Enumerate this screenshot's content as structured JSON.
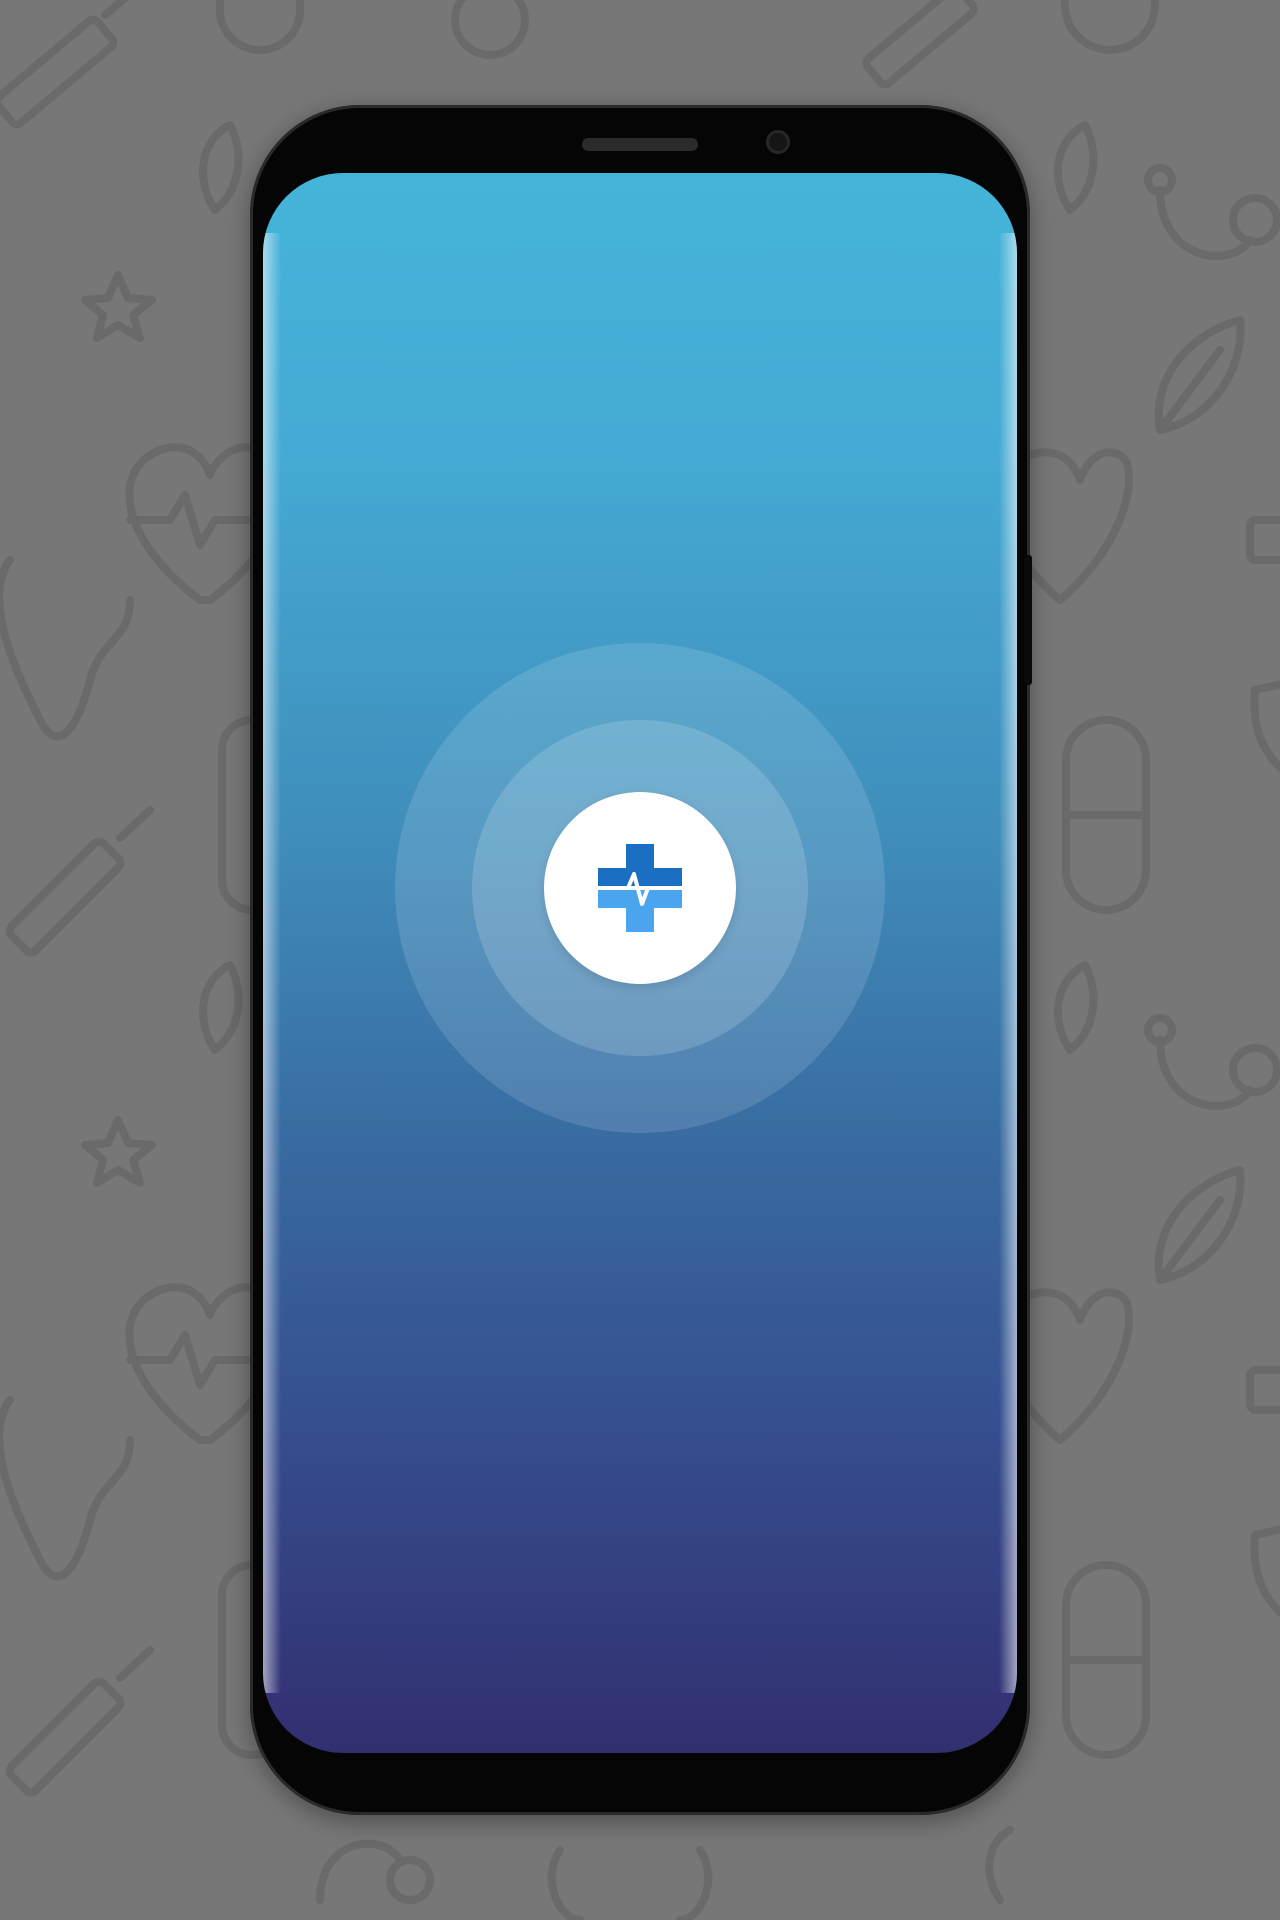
{
  "screen": {
    "name": "splash-screen",
    "gradient_top": "#45b4d9",
    "gradient_bottom": "#322f70"
  },
  "logo": {
    "icon": "medical-cross-heartbeat-icon",
    "color_dark": "#1b6fc2",
    "color_light": "#4aa5ee",
    "background": "#ffffff"
  },
  "background_pattern": {
    "color": "#6a6a6a",
    "icons": [
      "syringe-icon",
      "pill-icon",
      "heart-pulse-icon",
      "stethoscope-icon",
      "leaf-icon",
      "tooth-icon",
      "star-icon",
      "shield-icon"
    ]
  }
}
